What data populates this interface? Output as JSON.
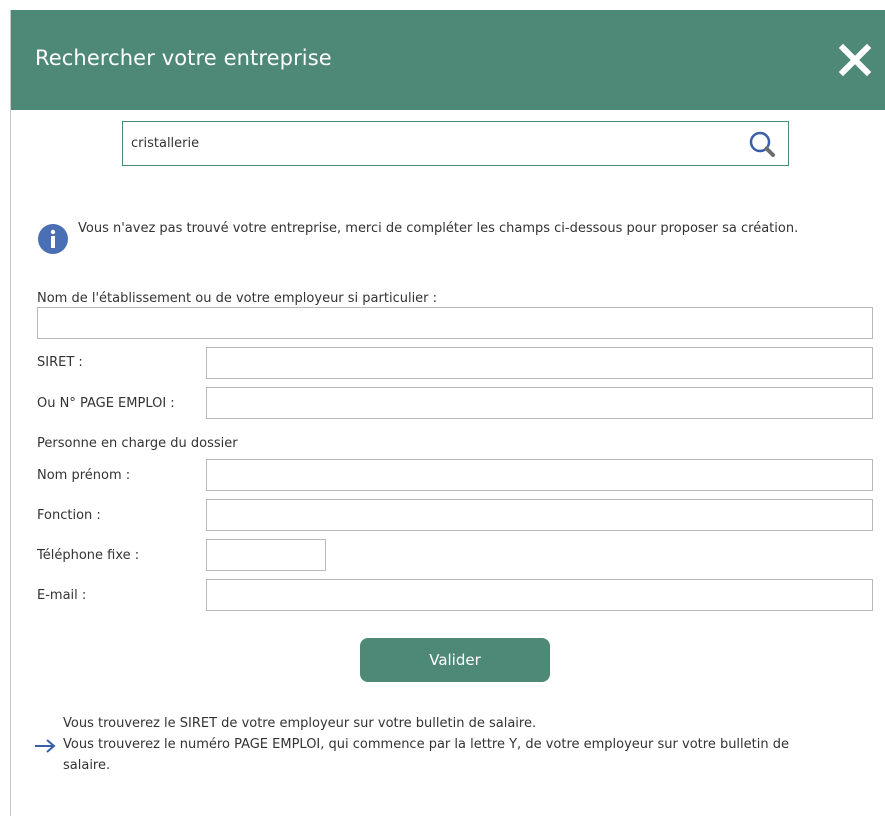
{
  "header": {
    "title": "Rechercher votre entreprise",
    "close_icon": "close-icon"
  },
  "search": {
    "value": "cristallerie",
    "icon": "search-icon"
  },
  "info": {
    "icon": "info-icon",
    "text": "Vous n'avez pas trouvé votre entreprise, merci de compléter les champs ci-dessous pour proposer sa création."
  },
  "form": {
    "nom_etablissement_label": "Nom de l'établissement ou de votre employeur si particulier :",
    "siret_label": "SIRET :",
    "page_emploi_label": "Ou N° PAGE EMPLOI :",
    "section_label": "Personne en charge du dossier",
    "nom_prenom_label": "Nom prénom :",
    "fonction_label": "Fonction :",
    "telephone_label": "Téléphone fixe :",
    "email_label": "E-mail :",
    "submit_label": "Valider"
  },
  "notes": {
    "line1": "Vous trouverez le SIRET de votre employeur sur votre bulletin de salaire.",
    "line2": "Vous trouverez le numéro PAGE EMPLOI, qui commence par la lettre Y, de votre employeur sur votre bulletin de",
    "line3": "salaire.",
    "arrow_icon": "arrow-right-icon"
  },
  "colors": {
    "accent": "#4e8977",
    "info_blue": "#4a6fb5",
    "search_icon_blue": "#3a5fa8"
  }
}
